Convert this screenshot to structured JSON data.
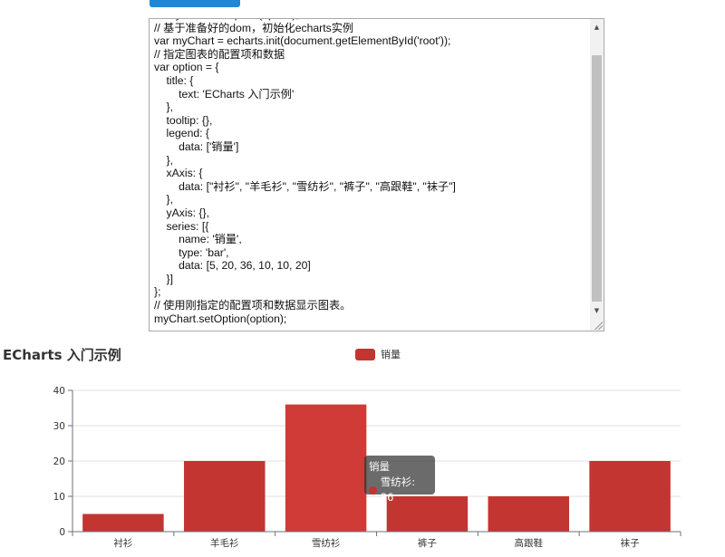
{
  "editor": {
    "code": "    myChart.setOption(option);\n// 基于准备好的dom，初始化echarts实例\nvar myChart = echarts.init(document.getElementById('root'));\n// 指定图表的配置项和数据\nvar option = {\n    title: {\n        text: 'ECharts 入门示例'\n    },\n    tooltip: {},\n    legend: {\n        data: ['销量']\n    },\n    xAxis: {\n        data: [\"衬衫\", \"羊毛衫\", \"雪纺衫\", \"裤子\", \"高跟鞋\", \"袜子\"]\n    },\n    yAxis: {},\n    series: [{\n        name: '销量',\n        type: 'bar',\n        data: [5, 20, 36, 10, 10, 20]\n    }]\n};\n// 使用刚指定的配置项和数据显示图表。\nmyChart.setOption(option);"
  },
  "colors": {
    "bar": "#c23531",
    "bar_highlight": "#d03b37",
    "axis": "#6e7079",
    "grid": "#e0e0e0",
    "run_button": "#1e87d8"
  },
  "icons": {
    "scroll_up": "▲",
    "scroll_down": "▼"
  },
  "tooltip": {
    "title": "销量",
    "item": "雪纺衫: 36"
  },
  "chart_data": {
    "type": "bar",
    "title": "ECharts 入门示例",
    "legend": [
      "销量"
    ],
    "legend_position": "top-center",
    "categories": [
      "衬衫",
      "羊毛衫",
      "雪纺衫",
      "裤子",
      "高跟鞋",
      "袜子"
    ],
    "series": [
      {
        "name": "销量",
        "values": [
          5,
          20,
          36,
          10,
          10,
          20
        ]
      }
    ],
    "ylim": [
      0,
      40
    ],
    "yticks": [
      0,
      10,
      20,
      30,
      40
    ],
    "grid": true,
    "highlighted_category": "雪纺衫"
  }
}
